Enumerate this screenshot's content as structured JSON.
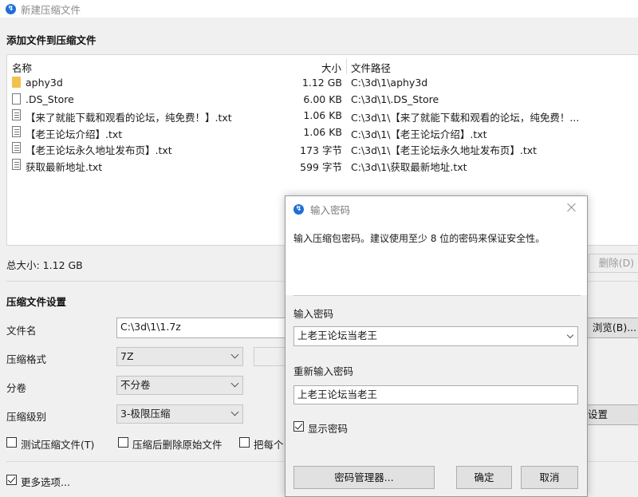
{
  "window": {
    "title": "新建压缩文件"
  },
  "add_section": {
    "title": "添加文件到压缩文件"
  },
  "file_list": {
    "columns": {
      "name": "名称",
      "size": "大小",
      "path": "文件路径"
    },
    "rows": [
      {
        "icon": "folder-icon",
        "name": "aphy3d",
        "size": "1.12 GB",
        "path": "C:\\3d\\1\\aphy3d"
      },
      {
        "icon": "file-icon",
        "name": ".DS_Store",
        "size": "6.00 KB",
        "path": "C:\\3d\\1\\.DS_Store"
      },
      {
        "icon": "text-file-icon",
        "name": "【来了就能下载和观看的论坛，纯免费！】.txt",
        "size": "1.06 KB",
        "path": "C:\\3d\\1\\【来了就能下载和观看的论坛，纯免费！..."
      },
      {
        "icon": "text-file-icon",
        "name": "【老王论坛介绍】.txt",
        "size": "1.06 KB",
        "path": "C:\\3d\\1\\【老王论坛介绍】.txt"
      },
      {
        "icon": "text-file-icon",
        "name": "【老王论坛永久地址发布页】.txt",
        "size": "173 字节",
        "path": "C:\\3d\\1\\【老王论坛永久地址发布页】.txt"
      },
      {
        "icon": "text-file-icon",
        "name": "获取最新地址.txt",
        "size": "599 字节",
        "path": "C:\\3d\\1\\获取最新地址.txt"
      }
    ]
  },
  "total_size": "总大小: 1.12 GB",
  "delete_button": "删除(D)",
  "settings": {
    "title": "压缩文件设置",
    "filename_label": "文件名",
    "filename_value": "C:\\3d\\1\\1.7z",
    "browse_button": "浏览(B)...",
    "format_label": "压缩格式",
    "format_value": "7Z",
    "split_label": "分卷",
    "split_value": "不分卷",
    "level_label": "压缩级别",
    "level_value": "3-极限压缩",
    "advanced_button_partial": "设置",
    "test_checkbox": "测试压缩文件(T)",
    "delete_after_checkbox": "压缩后删除原始文件",
    "each_checkbox_partial": "把每个",
    "more_options": "更多选项..."
  },
  "dialog": {
    "title": "输入密码",
    "description": "输入压缩包密码。建议使用至少 8 位的密码来保证安全性。",
    "password_label": "输入密码",
    "password_value": "上老王论坛当老王",
    "reenter_label": "重新输入密码",
    "reenter_value": "上老王论坛当老王",
    "show_password": "显示密码",
    "show_password_checked": true,
    "manager_button": "密码管理器...",
    "ok_button": "确定",
    "cancel_button": "取消"
  }
}
